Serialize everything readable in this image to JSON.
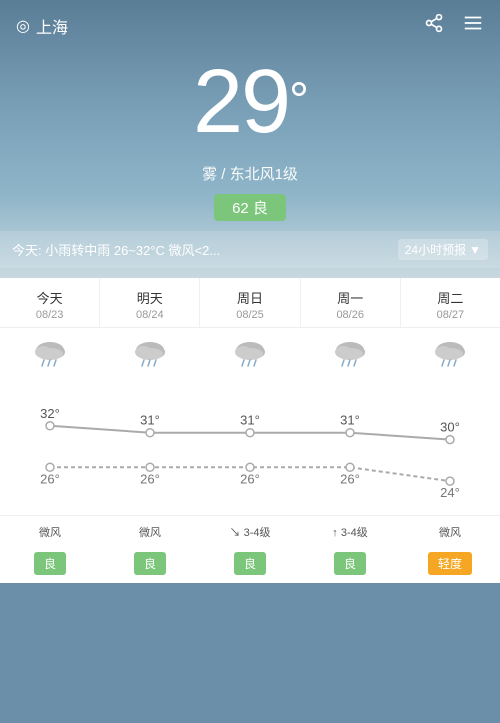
{
  "header": {
    "location": "上海",
    "share_icon": "⬆",
    "menu_icon": "☰",
    "temperature": "29",
    "degree_symbol": "°",
    "weather_desc": "雾 / 东北风1级",
    "aqi_value": "62 良",
    "today_bar": "今天: 小雨转中雨  26~32°C  微风<2...",
    "forecast_link": "24小时预报",
    "forecast_arrow": "▼"
  },
  "days": [
    {
      "name": "今天",
      "date": "08/23"
    },
    {
      "name": "明天",
      "date": "08/24"
    },
    {
      "name": "周日",
      "date": "08/25"
    },
    {
      "name": "周一",
      "date": "08/26"
    },
    {
      "name": "周二",
      "date": "08/27"
    }
  ],
  "high_temps": [
    "32°",
    "31°",
    "31°",
    "31°",
    "30°"
  ],
  "low_temps": [
    "26°",
    "26°",
    "26°",
    "26°",
    "24°"
  ],
  "wind": [
    "微风",
    "微风",
    "↘ 3-4级",
    "↑ 3-4级",
    "微风"
  ],
  "aqi_labels": [
    "良",
    "良",
    "良",
    "良",
    "轻度"
  ],
  "aqi_types": [
    "good",
    "good",
    "good",
    "good",
    "mild"
  ],
  "chart": {
    "high_points": [
      32,
      31,
      31,
      31,
      30
    ],
    "low_points": [
      26,
      26,
      26,
      26,
      24
    ],
    "min_temp": 22,
    "max_temp": 35
  }
}
